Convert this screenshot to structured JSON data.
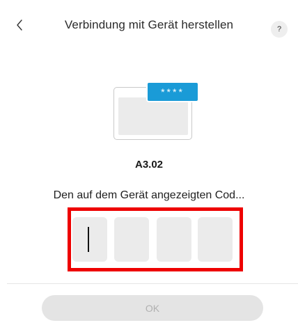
{
  "header": {
    "back_icon": "chevron-left-icon",
    "title": "Verbindung mit Gerät herstellen",
    "help_label": "?"
  },
  "illustration": {
    "badge_text": "****",
    "badge_color": "#1a9bd7"
  },
  "device": {
    "name": "A3.02"
  },
  "instruction": {
    "text": "Den auf dem Gerät angezeigten Cod..."
  },
  "code_input": {
    "cells": [
      "",
      "",
      "",
      ""
    ],
    "focused_cell": 1,
    "highlight_color": "#ee0000"
  },
  "footer": {
    "ok_label": "OK",
    "ok_enabled": false
  }
}
